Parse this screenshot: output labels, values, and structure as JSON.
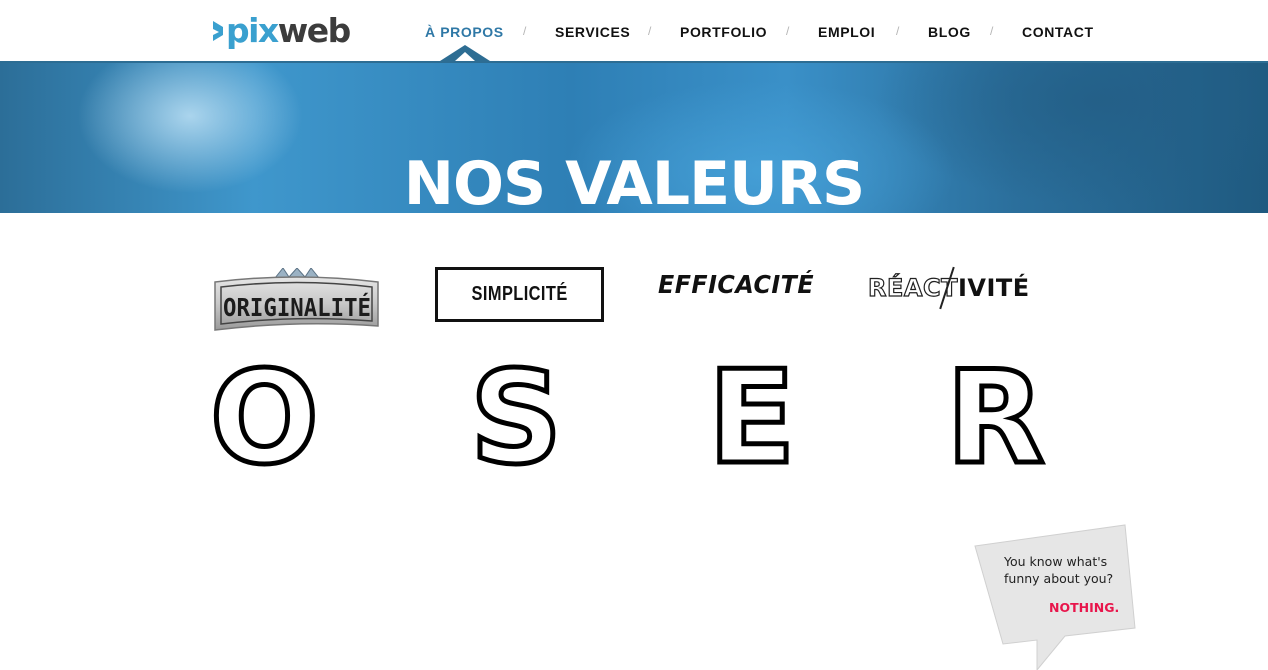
{
  "logo": {
    "part1": "pix",
    "part2": "web"
  },
  "nav": {
    "items": [
      {
        "label": "À PROPOS",
        "active": true
      },
      {
        "label": "SERVICES",
        "active": false
      },
      {
        "label": "PORTFOLIO",
        "active": false
      },
      {
        "label": "EMPLOI",
        "active": false
      },
      {
        "label": "BLOG",
        "active": false
      },
      {
        "label": "CONTACT",
        "active": false
      }
    ],
    "separator": "/"
  },
  "hero": {
    "title": "NOS VALEURS"
  },
  "values": {
    "originalite": "ORIGINALITÉ",
    "simplicite": "SIMPLICITÉ",
    "efficacite": "EFFICACITÉ",
    "reactivite_outline": "RÉACT",
    "reactivite_fill": "IVITÉ"
  },
  "letters": [
    "O",
    "S",
    "E",
    "R"
  ],
  "bubble": {
    "line1": "You know what's",
    "line2": "funny about you?",
    "punchline": "NOTHING."
  },
  "colors": {
    "accent": "#2f78a6",
    "logo_blue": "#3aa0cf",
    "punchline": "#e8154b"
  }
}
